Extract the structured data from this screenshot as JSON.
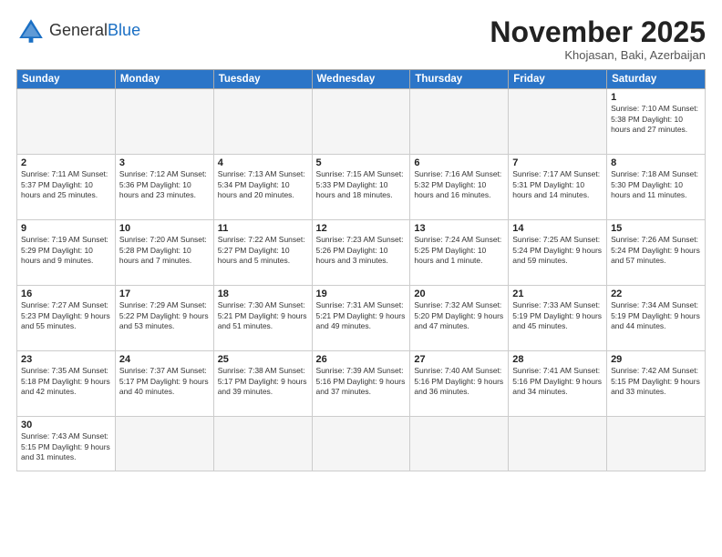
{
  "logo": {
    "general": "General",
    "blue": "Blue"
  },
  "title": "November 2025",
  "subtitle": "Khojasan, Baki, Azerbaijan",
  "weekdays": [
    "Sunday",
    "Monday",
    "Tuesday",
    "Wednesday",
    "Thursday",
    "Friday",
    "Saturday"
  ],
  "weeks": [
    [
      {
        "day": "",
        "info": ""
      },
      {
        "day": "",
        "info": ""
      },
      {
        "day": "",
        "info": ""
      },
      {
        "day": "",
        "info": ""
      },
      {
        "day": "",
        "info": ""
      },
      {
        "day": "",
        "info": ""
      },
      {
        "day": "1",
        "info": "Sunrise: 7:10 AM\nSunset: 5:38 PM\nDaylight: 10 hours\nand 27 minutes."
      }
    ],
    [
      {
        "day": "2",
        "info": "Sunrise: 7:11 AM\nSunset: 5:37 PM\nDaylight: 10 hours\nand 25 minutes."
      },
      {
        "day": "3",
        "info": "Sunrise: 7:12 AM\nSunset: 5:36 PM\nDaylight: 10 hours\nand 23 minutes."
      },
      {
        "day": "4",
        "info": "Sunrise: 7:13 AM\nSunset: 5:34 PM\nDaylight: 10 hours\nand 20 minutes."
      },
      {
        "day": "5",
        "info": "Sunrise: 7:15 AM\nSunset: 5:33 PM\nDaylight: 10 hours\nand 18 minutes."
      },
      {
        "day": "6",
        "info": "Sunrise: 7:16 AM\nSunset: 5:32 PM\nDaylight: 10 hours\nand 16 minutes."
      },
      {
        "day": "7",
        "info": "Sunrise: 7:17 AM\nSunset: 5:31 PM\nDaylight: 10 hours\nand 14 minutes."
      },
      {
        "day": "8",
        "info": "Sunrise: 7:18 AM\nSunset: 5:30 PM\nDaylight: 10 hours\nand 11 minutes."
      }
    ],
    [
      {
        "day": "9",
        "info": "Sunrise: 7:19 AM\nSunset: 5:29 PM\nDaylight: 10 hours\nand 9 minutes."
      },
      {
        "day": "10",
        "info": "Sunrise: 7:20 AM\nSunset: 5:28 PM\nDaylight: 10 hours\nand 7 minutes."
      },
      {
        "day": "11",
        "info": "Sunrise: 7:22 AM\nSunset: 5:27 PM\nDaylight: 10 hours\nand 5 minutes."
      },
      {
        "day": "12",
        "info": "Sunrise: 7:23 AM\nSunset: 5:26 PM\nDaylight: 10 hours\nand 3 minutes."
      },
      {
        "day": "13",
        "info": "Sunrise: 7:24 AM\nSunset: 5:25 PM\nDaylight: 10 hours\nand 1 minute."
      },
      {
        "day": "14",
        "info": "Sunrise: 7:25 AM\nSunset: 5:24 PM\nDaylight: 9 hours\nand 59 minutes."
      },
      {
        "day": "15",
        "info": "Sunrise: 7:26 AM\nSunset: 5:24 PM\nDaylight: 9 hours\nand 57 minutes."
      }
    ],
    [
      {
        "day": "16",
        "info": "Sunrise: 7:27 AM\nSunset: 5:23 PM\nDaylight: 9 hours\nand 55 minutes."
      },
      {
        "day": "17",
        "info": "Sunrise: 7:29 AM\nSunset: 5:22 PM\nDaylight: 9 hours\nand 53 minutes."
      },
      {
        "day": "18",
        "info": "Sunrise: 7:30 AM\nSunset: 5:21 PM\nDaylight: 9 hours\nand 51 minutes."
      },
      {
        "day": "19",
        "info": "Sunrise: 7:31 AM\nSunset: 5:21 PM\nDaylight: 9 hours\nand 49 minutes."
      },
      {
        "day": "20",
        "info": "Sunrise: 7:32 AM\nSunset: 5:20 PM\nDaylight: 9 hours\nand 47 minutes."
      },
      {
        "day": "21",
        "info": "Sunrise: 7:33 AM\nSunset: 5:19 PM\nDaylight: 9 hours\nand 45 minutes."
      },
      {
        "day": "22",
        "info": "Sunrise: 7:34 AM\nSunset: 5:19 PM\nDaylight: 9 hours\nand 44 minutes."
      }
    ],
    [
      {
        "day": "23",
        "info": "Sunrise: 7:35 AM\nSunset: 5:18 PM\nDaylight: 9 hours\nand 42 minutes."
      },
      {
        "day": "24",
        "info": "Sunrise: 7:37 AM\nSunset: 5:17 PM\nDaylight: 9 hours\nand 40 minutes."
      },
      {
        "day": "25",
        "info": "Sunrise: 7:38 AM\nSunset: 5:17 PM\nDaylight: 9 hours\nand 39 minutes."
      },
      {
        "day": "26",
        "info": "Sunrise: 7:39 AM\nSunset: 5:16 PM\nDaylight: 9 hours\nand 37 minutes."
      },
      {
        "day": "27",
        "info": "Sunrise: 7:40 AM\nSunset: 5:16 PM\nDaylight: 9 hours\nand 36 minutes."
      },
      {
        "day": "28",
        "info": "Sunrise: 7:41 AM\nSunset: 5:16 PM\nDaylight: 9 hours\nand 34 minutes."
      },
      {
        "day": "29",
        "info": "Sunrise: 7:42 AM\nSunset: 5:15 PM\nDaylight: 9 hours\nand 33 minutes."
      }
    ],
    [
      {
        "day": "30",
        "info": "Sunrise: 7:43 AM\nSunset: 5:15 PM\nDaylight: 9 hours\nand 31 minutes."
      },
      {
        "day": "",
        "info": ""
      },
      {
        "day": "",
        "info": ""
      },
      {
        "day": "",
        "info": ""
      },
      {
        "day": "",
        "info": ""
      },
      {
        "day": "",
        "info": ""
      },
      {
        "day": "",
        "info": ""
      }
    ]
  ]
}
